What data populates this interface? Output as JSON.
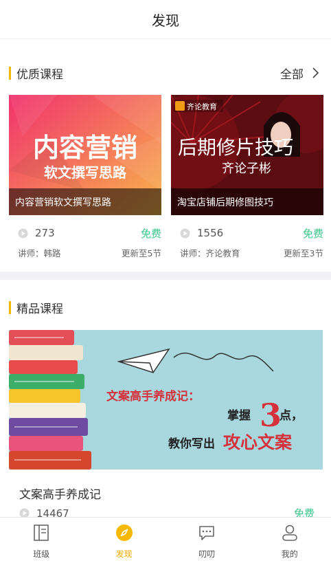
{
  "header": {
    "title": "发现"
  },
  "quality": {
    "title": "优质课程",
    "all_label": "全部",
    "cards": [
      {
        "cover_line1": "内容营销",
        "cover_line2": "软文撰写思路",
        "caption": "内容营销软文撰写思路",
        "plays": "273",
        "price": "免费",
        "lecturer": "讲师：韩路",
        "update": "更新至5节"
      },
      {
        "cover_brand": "齐论教育",
        "cover_line1": "后期修片技巧",
        "cover_line2": "齐论子彬",
        "caption": "淘宝店铺后期修图技巧",
        "plays": "1556",
        "price": "免费",
        "lecturer": "讲师：齐论教育",
        "update": "更新至3节"
      }
    ]
  },
  "premium": {
    "title": "精品课程",
    "banner": {
      "headline": "文案高手养成记：",
      "line2a": "掌握",
      "line2num": "3",
      "line2b": "点，",
      "line3a": "教你写出",
      "line3b": "攻心文案"
    },
    "course": {
      "title": "文案高手养成记",
      "plays": "14467",
      "price": "免费"
    }
  },
  "tabs": [
    {
      "label": "班级",
      "icon": "class-book-icon"
    },
    {
      "label": "发现",
      "icon": "compass-icon",
      "active": true
    },
    {
      "label": "叨叨",
      "icon": "chat-bubble-icon"
    },
    {
      "label": "我的",
      "icon": "profile-icon"
    }
  ],
  "colors": {
    "accent": "#f6b800",
    "free_green": "#3cc78a",
    "active_tab": "#f4a900"
  }
}
